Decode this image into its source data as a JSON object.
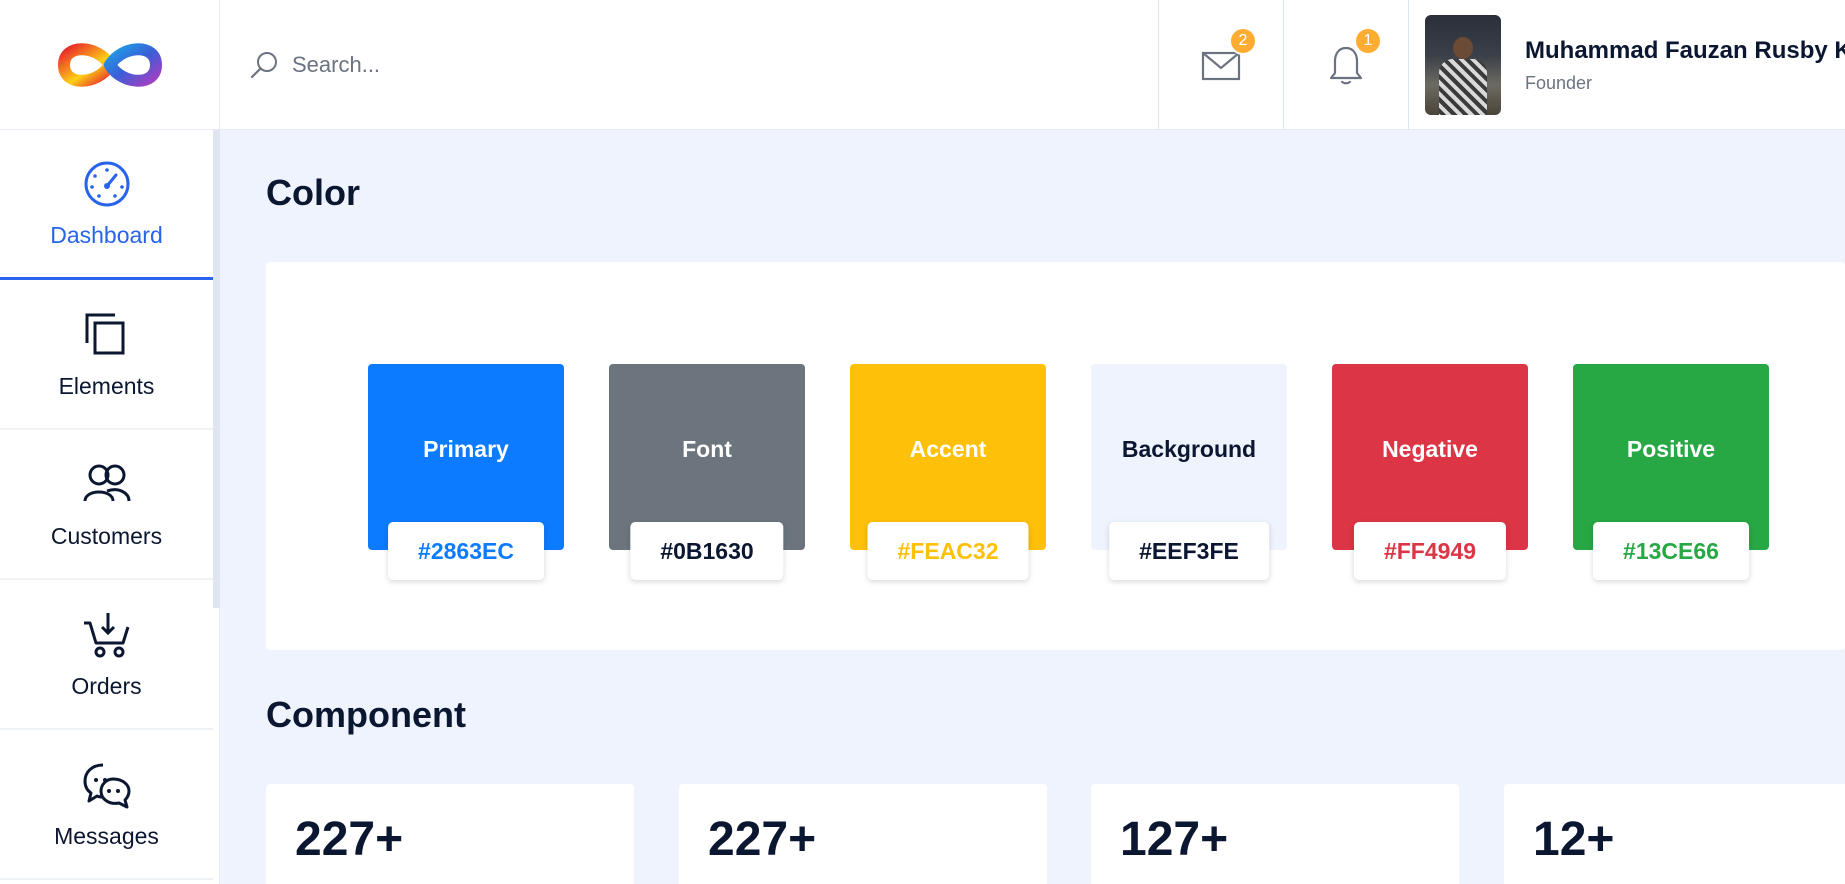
{
  "header": {
    "search_placeholder": "Search...",
    "mail_badge": "2",
    "notification_badge": "1",
    "user": {
      "name": "Muhammad Fauzan Rusby K",
      "role": "Founder"
    }
  },
  "sidebar": {
    "items": [
      {
        "label": "Dashboard",
        "icon": "speedometer-icon",
        "active": true
      },
      {
        "label": "Elements",
        "icon": "copy-icon",
        "active": false
      },
      {
        "label": "Customers",
        "icon": "users-icon",
        "active": false
      },
      {
        "label": "Orders",
        "icon": "cart-icon",
        "active": false
      },
      {
        "label": "Messages",
        "icon": "chat-icon",
        "active": false
      }
    ]
  },
  "main": {
    "color_section_title": "Color",
    "component_section_title": "Component",
    "colors": [
      {
        "name": "Primary",
        "code": "#2863EC",
        "swatch": "#0D7BFF",
        "text": "#ffffff",
        "code_color": "#0D7BFF"
      },
      {
        "name": "Font",
        "code": "#0B1630",
        "swatch": "#6C757E",
        "text": "#ffffff",
        "code_color": "#0B1630"
      },
      {
        "name": "Accent",
        "code": "#FEAC32",
        "swatch": "#FEC009",
        "text": "#ffffff",
        "code_color": "#FEC009"
      },
      {
        "name": "Background",
        "code": "#EEF3FE",
        "swatch": "#EEF3FE",
        "text": "#0B1630",
        "code_color": "#0B1630"
      },
      {
        "name": "Negative",
        "code": "#FF4949",
        "swatch": "#DC3545",
        "text": "#ffffff",
        "code_color": "#DC3545"
      },
      {
        "name": "Positive",
        "code": "#13CE66",
        "swatch": "#28A745",
        "text": "#ffffff",
        "code_color": "#28A745"
      }
    ],
    "stats": [
      "227+",
      "227+",
      "127+",
      "12+"
    ]
  }
}
